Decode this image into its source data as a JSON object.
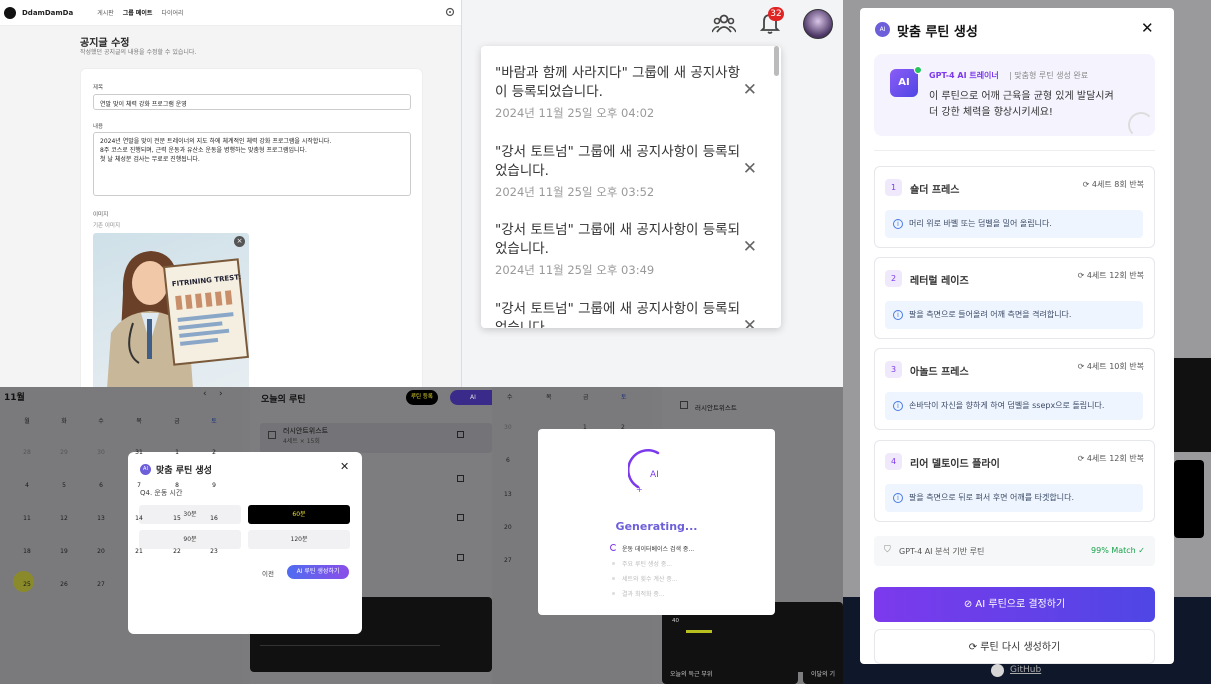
{
  "edit_page": {
    "brand": "DdamDamDa",
    "nav": [
      "게시판",
      "그룹 메이트",
      "다이어리"
    ],
    "title": "공지글 수정",
    "subtitle": "작성했던 공지글의 내용을 수정할 수 있습니다.",
    "title_label": "제목",
    "title_value": "연말 맞이 체력 강화 프로그램 운영",
    "content_label": "내용",
    "content_value": "2024년 연말을 맞이 전문 트레이너의 지도 하에 체계적인 체력 강화 프로그램을 시작합니다.\n8주 코스로 진행되며, 근력 운동과 유산소 운동을 병행하는 맞춤형 프로그램입니다.\n첫 날 체성분 검사는 무료로 진행됩니다.",
    "image_label": "이미지",
    "existing_image_label": "기존 이미지",
    "image_poster_text": "FITRINING TREST:"
  },
  "header": {
    "notification_count": "32"
  },
  "notifications": [
    {
      "message": "\"바람과 함께 사라지다\" 그룹에 새 공지사항이 등록되었습니다.",
      "time": "2024년 11월 25일 오후 04:02"
    },
    {
      "message": "\"강서 토트넘\" 그룹에 새 공지사항이 등록되었습니다.",
      "time": "2024년 11월 25일 오후 03:52"
    },
    {
      "message": "\"강서 토트넘\" 그룹에 새 공지사항이 등록되었습니다.",
      "time": "2024년 11월 25일 오후 03:49"
    },
    {
      "message": "\"강서 토트넘\" 그룹에 새 공지사항이 등록되었습니다.",
      "time": ""
    }
  ],
  "calendar": {
    "month": "11월",
    "weekdays": [
      "월",
      "화",
      "수",
      "목",
      "금",
      "토"
    ],
    "rows": [
      [
        "28",
        "29",
        "30",
        "31",
        "1",
        "2"
      ],
      [
        "4",
        "5",
        "6",
        "7",
        "8",
        "9"
      ],
      [
        "11",
        "12",
        "13",
        "14",
        "15",
        "16"
      ],
      [
        "18",
        "19",
        "20",
        "21",
        "22",
        "23"
      ],
      [
        "25",
        "26",
        "27",
        "",
        "",
        ""
      ]
    ],
    "today": "25"
  },
  "routine_panel": {
    "title": "오늘의 루틴",
    "register_label": "루틴 등록",
    "ai_label": "AI",
    "item_name": "러시안트위스트",
    "item_detail": "4세트 × 15회"
  },
  "question_modal": {
    "title": "맞춤 루틴 생성",
    "question": "Q4. 운동 시간",
    "options": [
      "30분",
      "60분",
      "90분",
      "120분"
    ],
    "selected": "60분",
    "prev_label": "이전",
    "generate_label": "AI 루틴 생성하기"
  },
  "generating": {
    "ai_label": "AI",
    "title": "Generating...",
    "steps": [
      "운동 데이터베이스 검색 중...",
      "주요 루틴 생성 중...",
      "세트와 횟수 계산 중...",
      "결과 최적화 중..."
    ],
    "bg_weekdays": [
      "수",
      "목",
      "금",
      "토"
    ],
    "bg_item": "러시안트위스트",
    "bg_days": [
      "30",
      "6",
      "13",
      "20",
      "27"
    ],
    "bg_dates": [
      "1",
      "2"
    ],
    "bg_chart_tick": "40",
    "bg_bottom_left": "오늘의 득근 부위",
    "bg_bottom_right": "이달의 기"
  },
  "ai_routine": {
    "title": "맞춤 루틴 생성",
    "trainer_label": "GPT-4 AI 트레이너",
    "trainer_status": "맞춤형 루틴 생성 완료",
    "advice": "이 루틴으로 어깨 근육을 균형 있게 발달시켜 더 강한 체력을 향상시키세요!",
    "exercises": [
      {
        "num": "1",
        "name": "숄더 프레스",
        "sets": "4세트 8회 반복",
        "tip": "머리 위로 바벨 또는 덤벨을 밀어 올립니다."
      },
      {
        "num": "2",
        "name": "레터럴 레이즈",
        "sets": "4세트 12회 반복",
        "tip": "팔을 측면으로 들어올려 어깨 측면을 격려합니다."
      },
      {
        "num": "3",
        "name": "아놀드 프레스",
        "sets": "4세트 10회 반복",
        "tip": "손바닥이 자신을 향하게 하여 덤벨을 ssepx으로 돌립니다."
      },
      {
        "num": "4",
        "name": "리어 델토이드 플라이",
        "sets": "4세트 12회 반복",
        "tip": "팔을 측면으로 뒤로 펴서 후면 어깨를 타겟합니다."
      }
    ],
    "footer_label": "GPT-4 AI 분석 기반 루틴",
    "match": "99% Match",
    "confirm_label": "AI 루틴으로 결정하기",
    "regen_label": "루틴 다시 생성하기",
    "github_label": "GitHub"
  },
  "colors": {
    "accent": "#7c3aed",
    "accent2": "#4f46e5",
    "badge": "#e02424"
  }
}
